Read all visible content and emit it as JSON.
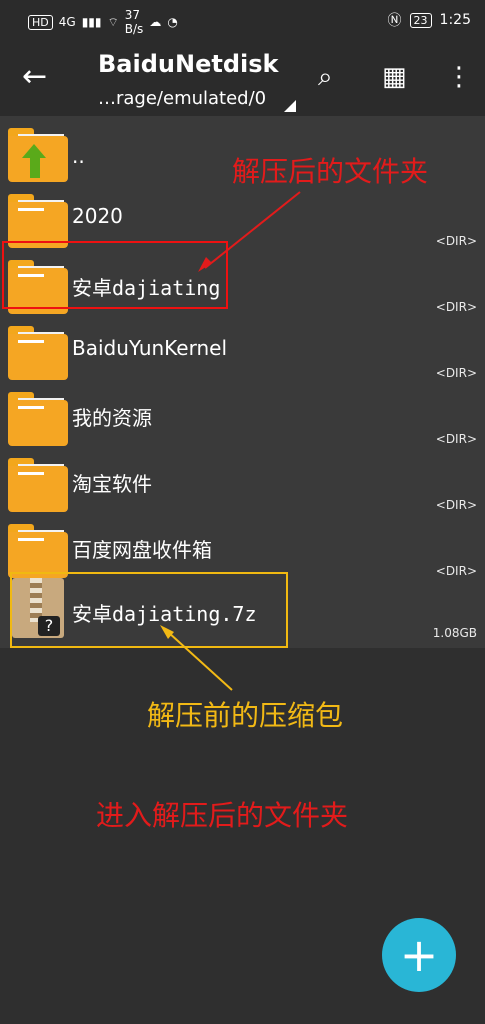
{
  "status_bar": {
    "left_items": [
      "HD",
      "4G",
      "37",
      "B/s"
    ],
    "battery": "23",
    "time": "1:25"
  },
  "toolbar": {
    "title": "BaiduNetdisk",
    "path": "…rage/emulated/0"
  },
  "files": [
    {
      "name": "..",
      "meta": ""
    },
    {
      "name": "2020",
      "meta": "<DIR>"
    },
    {
      "name": "安卓dajiating",
      "meta": "<DIR>"
    },
    {
      "name": "BaiduYunKernel",
      "meta": "<DIR>"
    },
    {
      "name": "我的资源",
      "meta": "<DIR>"
    },
    {
      "name": "淘宝软件",
      "meta": "<DIR>"
    },
    {
      "name": "百度网盘收件箱",
      "meta": "<DIR>"
    },
    {
      "name": "安卓dajiating.7z",
      "meta": "1.08GB"
    }
  ],
  "annotations": {
    "after_extract_folder": "解压后的文件夹",
    "before_extract_archive": "解压前的压缩包",
    "enter_after_extract_folder": "进入解压后的文件夹",
    "colors": {
      "red": "#e21b1b",
      "yellow": "#f2b915"
    }
  },
  "fab": {
    "label": "+"
  }
}
